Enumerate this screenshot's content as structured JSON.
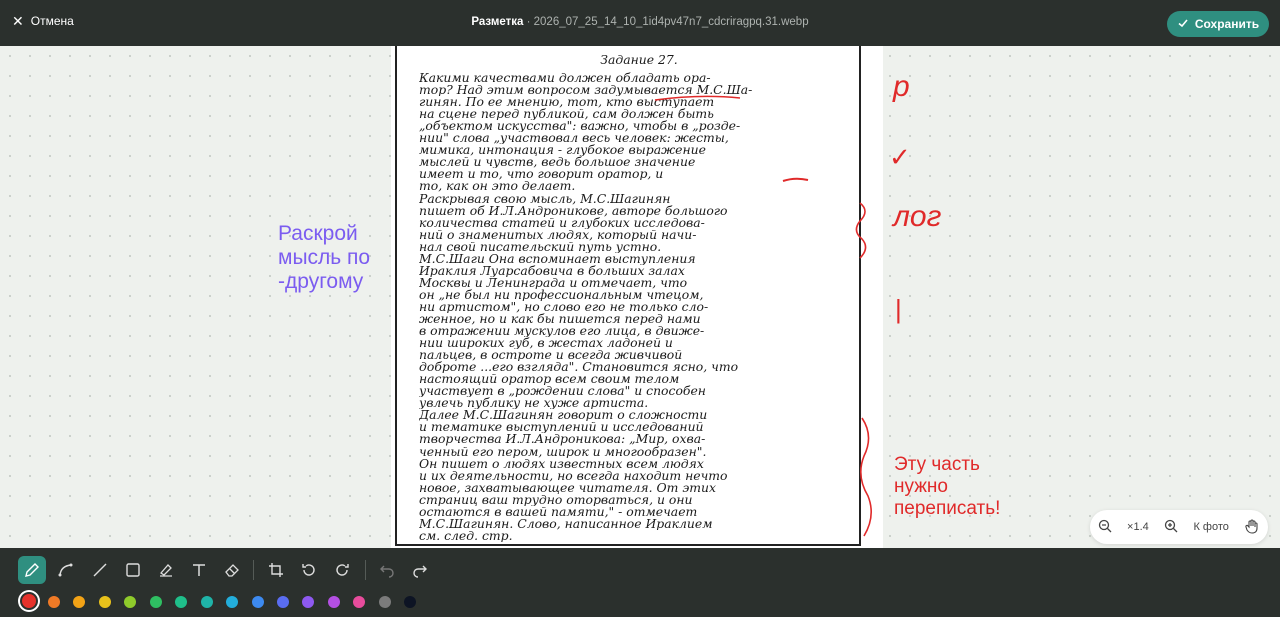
{
  "header": {
    "cancel_label": "Отмена",
    "title_bold": "Разметка",
    "title_sep": " · ",
    "filename": "2026_07_25_14_10_1id4pv47n7_cdcriragpq.31.webp",
    "save_label": "Сохранить"
  },
  "document": {
    "title": "Задание 27.",
    "lines": [
      "Какими качествами должен обладать ора-",
      "тор? Над этим вопросом задумывается М.С.Ша-",
      "гинян. По ее мнению, тот, кто выступает",
      "на сцене перед публикой, сам должен быть",
      "„объектом искусства\": важно, чтобы в „розде-",
      "нии\" слова „участвовал весь человек: жесты,",
      "мимика, интонация - глубокое выражение",
      "мыслей и чувств, ведь большое значение",
      "имеет и то, что говорит оратор, и",
      "то, как он это делает.",
      "Раскрывая свою мысль, М.С.Шагинян",
      "пишет об И.Л.Андроникове, авторе большого",
      "количества статей и глубоких исследова-",
      "ний о знаменитых людях, который начи-",
      "нал свой писательский путь устно.",
      "М.С.Шаги Она вспоминает выступления",
      "Ираклия Луарсабовича в больших залах",
      "Москвы и Ленинграда и отмечает, что",
      "он „не был ни профессиональным чтецом,",
      "ни артистом\", но слово его не только сло-",
      "женное, но и как бы пишется перед нами",
      "в отражении мускулов его лица, в движе-",
      "нии широких губ, в жестах ладоней и",
      "пальцев, в остроте и всегда живчивой",
      "доброте ...его взгляда\". Становится ясно, что",
      "настоящий оратор всем своим телом",
      "участвует в „рождении слова\" и способен",
      "увлечь публику не хуже артиста.",
      "Далее М.С.Шагинян говорит о сложности",
      "и тематике выступлений и исследований",
      "творчества И.Л.Андроникова: „Мир, охва-",
      "ченный его пером, широк и многообразен\".",
      "Он пишет о людях известных всем людях",
      "и их деятельности, но всегда находит нечто",
      "новое, захватывающее читателя. От этих",
      "страниц ваш трудно оторваться, и они",
      "остаются в вашей памяти,\" - отмечает",
      "М.С.Шагинян. Слово, написанное Ираклием",
      "см. след. стр."
    ]
  },
  "annotations": {
    "margin_marks": [
      "р",
      "✓",
      "лог",
      "|"
    ],
    "left_note": [
      "Раскрой",
      "мысль по",
      "-другому"
    ],
    "right_note": [
      "Эту часть",
      "нужно",
      "переписать!"
    ]
  },
  "zoom": {
    "level": "×1.4",
    "fit_label": "К фото"
  },
  "toolbar": {
    "tools": [
      "pen-icon",
      "curve-icon",
      "line-icon",
      "rectangle-icon",
      "highlighter-icon",
      "text-icon",
      "eraser-icon",
      "crop-icon",
      "rotate-left-icon",
      "rotate-right-icon",
      "undo-icon",
      "redo-icon"
    ],
    "active_tool": "pen-icon",
    "selected_color": "#e5322b",
    "colors": [
      "#e5322b",
      "#f07a26",
      "#f3a316",
      "#e8c11b",
      "#8fcb2b",
      "#2fbf62",
      "#1fbf8a",
      "#1fb4a8",
      "#23aedb",
      "#3d8af0",
      "#5a6df2",
      "#8e59f0",
      "#b44fe3",
      "#e84c9c",
      "#7b7b7b",
      "#0d1424"
    ]
  }
}
